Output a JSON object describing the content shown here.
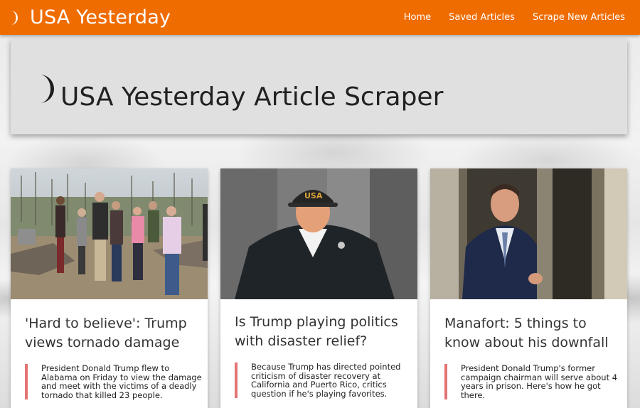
{
  "navbar": {
    "brand": "USA Yesterday",
    "links": [
      {
        "label": "Home"
      },
      {
        "label": "Saved Articles"
      },
      {
        "label": "Scrape New Articles"
      }
    ]
  },
  "jumbotron": {
    "title": "USA Yesterday Article Scraper",
    "icon": "crescent-moon-icon"
  },
  "articles": [
    {
      "title": "'Hard to believe': Trump views tornado damage",
      "summary": "President Donald Trump flew to Alabama on Friday to view the damage and meet with the victims of a deadly tornado that killed 23 people.",
      "image": "tornado-damage-photo"
    },
    {
      "title": "Is Trump playing politics with disaster relief?",
      "summary": "Because Trump has directed pointed criticism of disaster recovery at California and Puerto Rico, critics question if he's playing favorites.",
      "image": "trump-usa-cap-photo"
    },
    {
      "title": "Manafort: 5 things to know about his downfall",
      "summary": "President Donald Trump's former campaign chairman will serve about 4 years in prison. Here's how he got there.",
      "image": "manafort-photo"
    }
  ],
  "colors": {
    "navbar": "#ef6c00",
    "jumbotron": "#e0e0e0",
    "summary_border": "#e57373"
  },
  "image_caption_texts": {
    "cap_text": "USA"
  }
}
